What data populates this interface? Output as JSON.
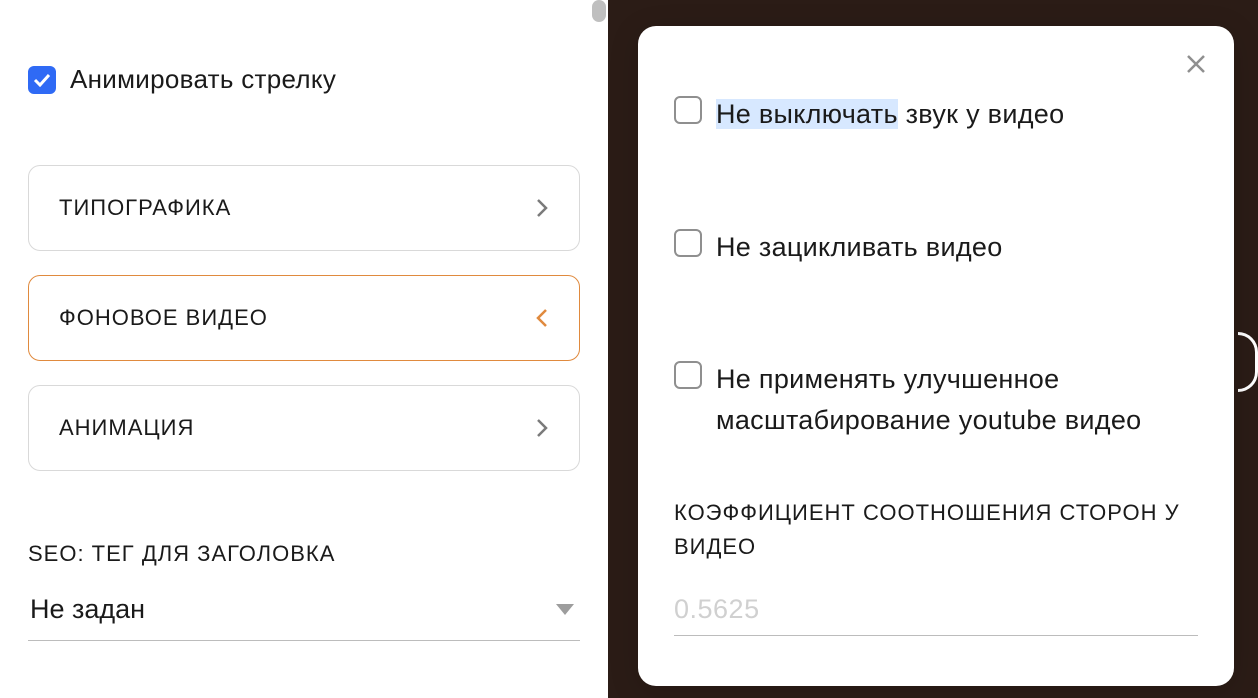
{
  "left": {
    "animate_arrow_label": "Анимировать стрелку",
    "animate_arrow_checked": true,
    "accordion": {
      "typography": "ТИПОГРАФИКА",
      "bg_video": "ФОНОВОЕ ВИДЕО",
      "animation": "АНИМАЦИЯ"
    },
    "seo_label": "SEO: ТЕГ ДЛЯ ЗАГОЛОВКА",
    "seo_value": "Не задан"
  },
  "popover": {
    "noMute": {
      "label_sel": "Не выключать",
      "label_rest": " звук у видео",
      "checked": false
    },
    "noLoop": {
      "label": "Не зацикливать видео",
      "checked": false
    },
    "noScale": {
      "label": "Не применять улучшенное масштабирование youtube видео",
      "checked": false
    },
    "ratio_label": "КОЭФФИЦИЕНТ СООТНОШЕНИЯ СТОРОН У ВИДЕО",
    "ratio_placeholder": "0.5625",
    "ratio_value": ""
  }
}
